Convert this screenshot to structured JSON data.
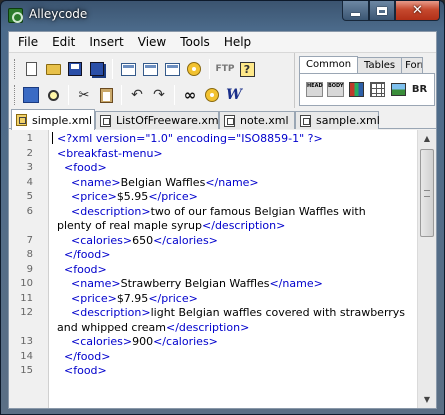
{
  "window": {
    "title": "Alleycode",
    "icon": "alleycode-app-icon",
    "controls": {
      "minimize": "minimize-icon",
      "maximize": "maximize-icon",
      "close": "✕"
    }
  },
  "menu": {
    "items": [
      {
        "label": "File"
      },
      {
        "label": "Edit"
      },
      {
        "label": "Insert"
      },
      {
        "label": "View"
      },
      {
        "label": "Tools"
      },
      {
        "label": "Help"
      }
    ]
  },
  "toolbar": {
    "ftp_label": "FTP",
    "help_label": "?",
    "row1_icons": [
      "new-document-icon",
      "open-folder-icon",
      "save-icon",
      "save-all-icon",
      "frame-icon",
      "table-icon",
      "form-icon",
      "settings-icon",
      "ftp-icon",
      "help-icon"
    ],
    "row2_icons": [
      "find-files-icon",
      "search-icon",
      "cut-icon",
      "paste-icon",
      "undo-icon",
      "redo-icon",
      "find-icon",
      "spellcheck-icon"
    ],
    "w_label": "W"
  },
  "palette": {
    "tabs": [
      {
        "label": "Common",
        "active": true
      },
      {
        "label": "Tables",
        "active": false
      },
      {
        "label": "Form",
        "active": false
      }
    ],
    "buttons": [
      {
        "label": "HEAD",
        "icon": "head-tag-icon"
      },
      {
        "label": "BODY",
        "icon": "body-tag-icon"
      },
      {
        "label": "",
        "icon": "books-icon"
      },
      {
        "label": "",
        "icon": "grid-icon"
      },
      {
        "label": "",
        "icon": "image-icon"
      },
      {
        "label": "BR",
        "icon": "line-break-icon"
      }
    ]
  },
  "tabs": [
    {
      "label": "simple.xml",
      "active": true
    },
    {
      "label": "ListOfFreeware.xml",
      "active": false
    },
    {
      "label": "note.xml",
      "active": false
    },
    {
      "label": "sample.xml",
      "active": false
    }
  ],
  "editor": {
    "line_numbers": [
      "1",
      "2",
      "3",
      "4",
      "5",
      "6",
      "",
      "7",
      "8",
      "9",
      "10",
      "11",
      "12",
      "",
      "13",
      "14",
      "15"
    ],
    "lines": [
      "<?xml version=\"1.0\" encoding=\"ISO8859-1\" ?>",
      "<breakfast-menu>",
      "  <food>",
      "    <name>Belgian Waffles</name>",
      "    <price>$5.95</price>",
      "    <description>two of our famous Belgian Waffles with",
      "plenty of real maple syrup</description>",
      "    <calories>650</calories>",
      "  </food>",
      "  <food>",
      "    <name>Strawberry Belgian Waffles</name>",
      "    <price>$7.95</price>",
      "    <description>light Belgian waffles covered with strawberrys",
      "and whipped cream</description>",
      "    <calories>900</calories>",
      "  </food>",
      "  <food>"
    ]
  },
  "colors": {
    "tag": "#0000cc",
    "text": "#000000",
    "titlebar": "#4b6a8a",
    "close_button": "#c6492e"
  }
}
